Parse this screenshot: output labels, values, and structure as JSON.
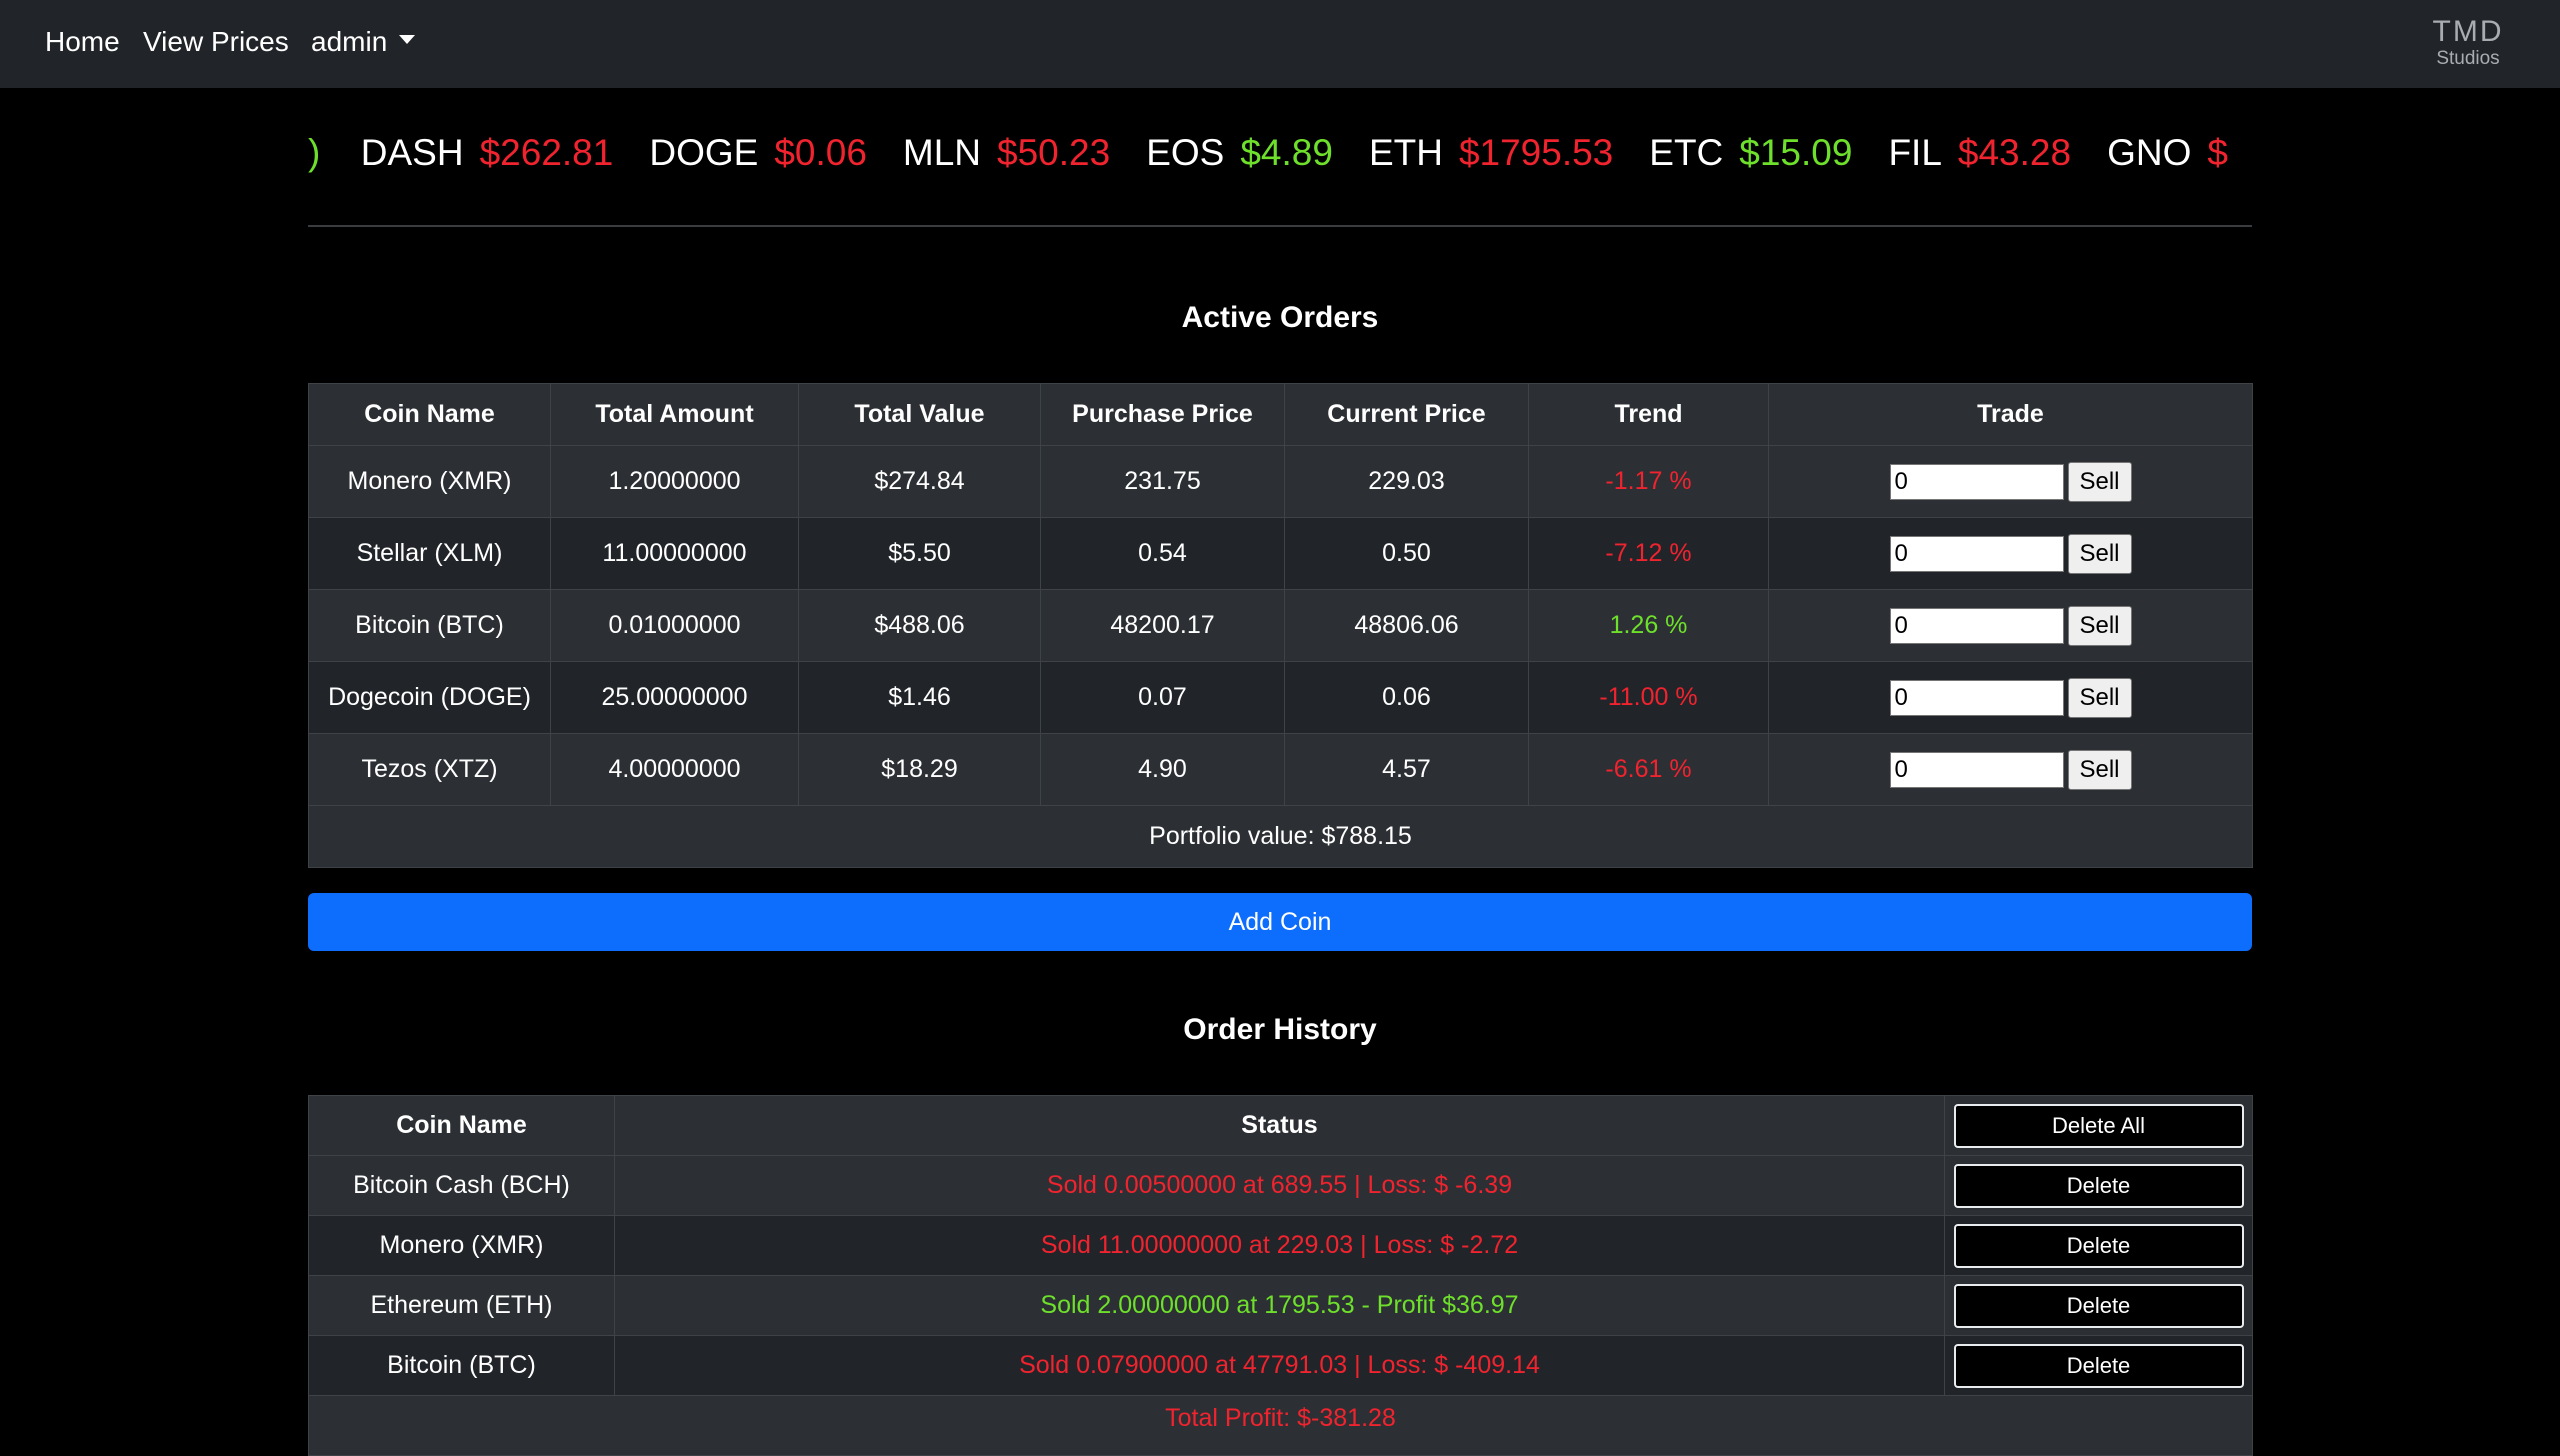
{
  "nav": {
    "home": "Home",
    "view_prices": "View Prices",
    "user": "admin",
    "logo_main": "TMD",
    "logo_sub": "Studios"
  },
  "ticker": {
    "leading_fragment": ")",
    "items": [
      {
        "symbol": "DASH",
        "price": "$262.81",
        "direction": "down"
      },
      {
        "symbol": "DOGE",
        "price": "$0.06",
        "direction": "down"
      },
      {
        "symbol": "MLN",
        "price": "$50.23",
        "direction": "down"
      },
      {
        "symbol": "EOS",
        "price": "$4.89",
        "direction": "up"
      },
      {
        "symbol": "ETH",
        "price": "$1795.53",
        "direction": "down"
      },
      {
        "symbol": "ETC",
        "price": "$15.09",
        "direction": "up"
      },
      {
        "symbol": "FIL",
        "price": "$43.28",
        "direction": "down"
      },
      {
        "symbol": "GNO",
        "price": "$",
        "direction": "down"
      }
    ]
  },
  "active_orders": {
    "title": "Active Orders",
    "headers": [
      "Coin Name",
      "Total Amount",
      "Total Value",
      "Purchase Price",
      "Current Price",
      "Trend",
      "Trade"
    ],
    "rows": [
      {
        "coin": "Monero (XMR)",
        "amount": "1.20000000",
        "value": "$274.84",
        "purchase": "231.75",
        "current": "229.03",
        "trend": "-1.17 %",
        "direction": "down",
        "qty": "0",
        "action": "Sell"
      },
      {
        "coin": "Stellar (XLM)",
        "amount": "11.00000000",
        "value": "$5.50",
        "purchase": "0.54",
        "current": "0.50",
        "trend": "-7.12 %",
        "direction": "down",
        "qty": "0",
        "action": "Sell"
      },
      {
        "coin": "Bitcoin (BTC)",
        "amount": "0.01000000",
        "value": "$488.06",
        "purchase": "48200.17",
        "current": "48806.06",
        "trend": "1.26 %",
        "direction": "up",
        "qty": "0",
        "action": "Sell"
      },
      {
        "coin": "Dogecoin (DOGE)",
        "amount": "25.00000000",
        "value": "$1.46",
        "purchase": "0.07",
        "current": "0.06",
        "trend": "-11.00 %",
        "direction": "down",
        "qty": "0",
        "action": "Sell"
      },
      {
        "coin": "Tezos (XTZ)",
        "amount": "4.00000000",
        "value": "$18.29",
        "purchase": "4.90",
        "current": "4.57",
        "trend": "-6.61 %",
        "direction": "down",
        "qty": "0",
        "action": "Sell"
      }
    ],
    "portfolio_value": "Portfolio value: $788.15"
  },
  "add_coin_label": "Add Coin",
  "order_history": {
    "title": "Order History",
    "headers": [
      "Coin Name",
      "Status"
    ],
    "delete_all_label": "Delete All",
    "delete_label": "Delete",
    "rows": [
      {
        "coin": "Bitcoin Cash (BCH)",
        "status": "Sold 0.00500000 at 689.55 | Loss: $ -6.39",
        "direction": "down"
      },
      {
        "coin": "Monero (XMR)",
        "status": "Sold 11.00000000 at 229.03 | Loss: $ -2.72",
        "direction": "down"
      },
      {
        "coin": "Ethereum (ETH)",
        "status": "Sold 2.00000000 at 1795.53 - Profit $36.97",
        "direction": "up"
      },
      {
        "coin": "Bitcoin (BTC)",
        "status": "Sold 0.07900000 at 47791.03 | Loss: $ -409.14",
        "direction": "down"
      }
    ],
    "total_profit": "Total Profit: $-381.28",
    "total_direction": "down"
  },
  "colors": {
    "up": "#6ee02c",
    "down": "#f0232e",
    "primary": "#0d6efd",
    "navbar": "#212529"
  }
}
